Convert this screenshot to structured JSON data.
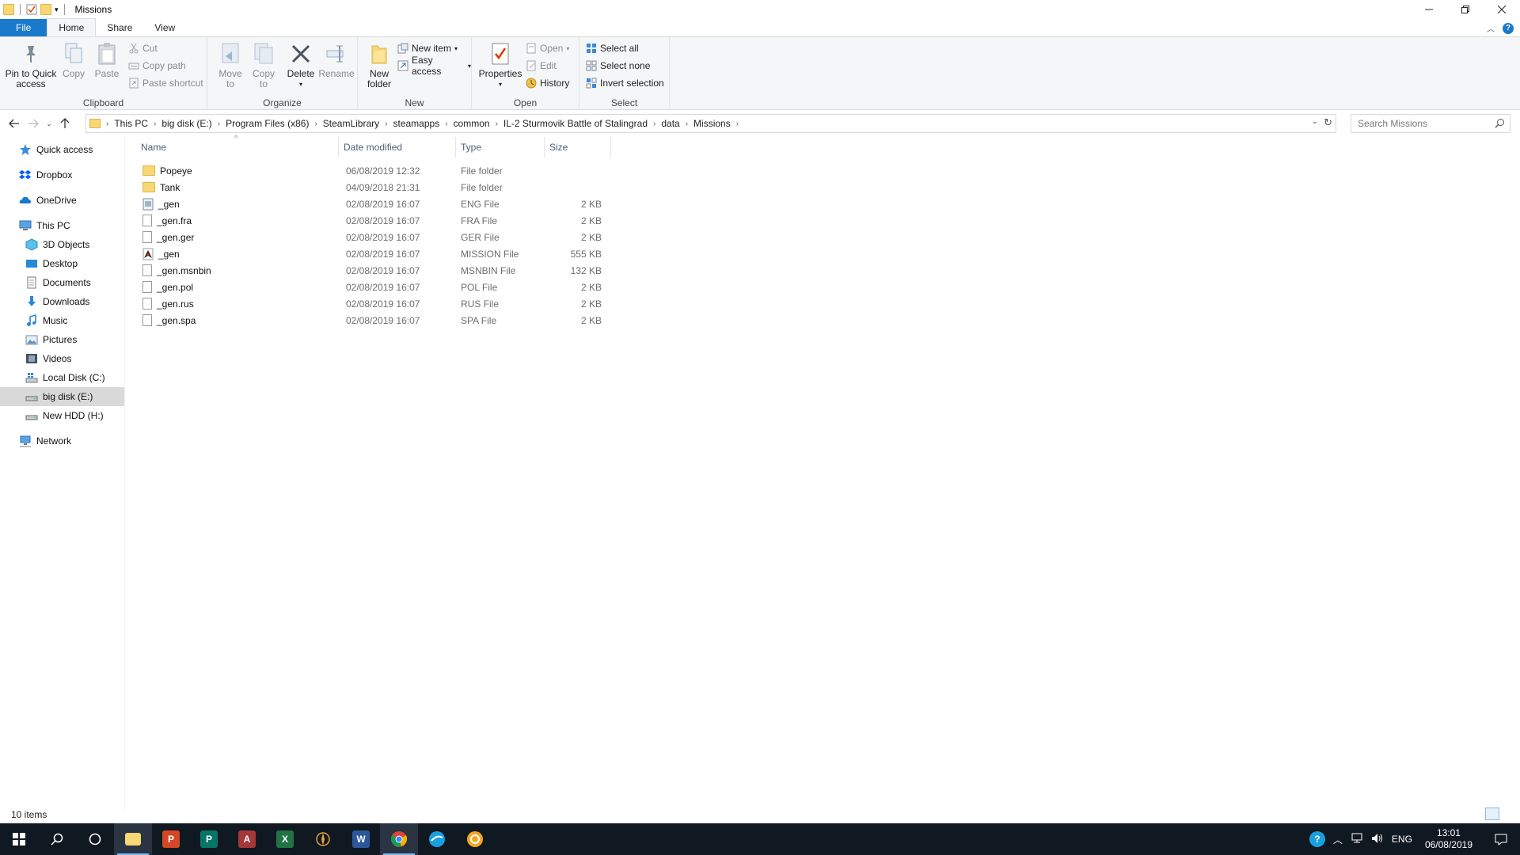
{
  "window": {
    "title": "Missions",
    "controls": [
      "minimize",
      "restore",
      "close"
    ]
  },
  "ribbon_tabs": [
    {
      "label": "File"
    },
    {
      "label": "Home"
    },
    {
      "label": "Share"
    },
    {
      "label": "View"
    }
  ],
  "ribbon": {
    "clipboard": {
      "label": "Clipboard",
      "pin_line1": "Pin to Quick",
      "pin_line2": "access",
      "copy": "Copy",
      "paste": "Paste",
      "cut": "Cut",
      "copy_path": "Copy path",
      "paste_shortcut": "Paste shortcut"
    },
    "organize": {
      "label": "Organize",
      "move_line1": "Move",
      "move_line2": "to",
      "copy_line1": "Copy",
      "copy_line2": "to",
      "delete": "Delete",
      "rename": "Rename"
    },
    "new": {
      "label": "New",
      "new_folder_line1": "New",
      "new_folder_line2": "folder",
      "new_item": "New item",
      "easy_access": "Easy access"
    },
    "open": {
      "label": "Open",
      "properties": "Properties",
      "open": "Open",
      "edit": "Edit",
      "history": "History"
    },
    "select": {
      "label": "Select",
      "select_all": "Select all",
      "select_none": "Select none",
      "invert_selection": "Invert selection"
    }
  },
  "address": {
    "breadcrumbs": [
      "This PC",
      "big disk (E:)",
      "Program Files (x86)",
      "SteamLibrary",
      "steamapps",
      "common",
      "IL-2 Sturmovik Battle of Stalingrad",
      "data",
      "Missions"
    ],
    "search_placeholder": "Search Missions"
  },
  "nav_pane": {
    "quick_access": "Quick access",
    "dropbox": "Dropbox",
    "onedrive": "OneDrive",
    "this_pc": "This PC",
    "objects_3d": "3D Objects",
    "desktop": "Desktop",
    "documents": "Documents",
    "downloads": "Downloads",
    "music": "Music",
    "pictures": "Pictures",
    "videos": "Videos",
    "local_disk": "Local Disk (C:)",
    "big_disk": "big disk (E:)",
    "new_hdd": "New HDD (H:)",
    "network": "Network"
  },
  "columns": {
    "name": "Name",
    "date": "Date modified",
    "type": "Type",
    "size": "Size"
  },
  "files": [
    {
      "name": "Popeye",
      "date": "06/08/2019 12:32",
      "type": "File folder",
      "size": "",
      "icon": "folder-icon"
    },
    {
      "name": "Tank",
      "date": "04/09/2018 21:31",
      "type": "File folder",
      "size": "",
      "icon": "folder-icon"
    },
    {
      "name": "_gen",
      "date": "02/08/2019 16:07",
      "type": "ENG File",
      "size": "2 KB",
      "icon": "eng-file-icon"
    },
    {
      "name": "_gen.fra",
      "date": "02/08/2019 16:07",
      "type": "FRA File",
      "size": "2 KB",
      "icon": "file-icon"
    },
    {
      "name": "_gen.ger",
      "date": "02/08/2019 16:07",
      "type": "GER File",
      "size": "2 KB",
      "icon": "file-icon"
    },
    {
      "name": "_gen",
      "date": "02/08/2019 16:07",
      "type": "MISSION File",
      "size": "555 KB",
      "icon": "mission-file-icon"
    },
    {
      "name": "_gen.msnbin",
      "date": "02/08/2019 16:07",
      "type": "MSNBIN File",
      "size": "132 KB",
      "icon": "file-icon"
    },
    {
      "name": "_gen.pol",
      "date": "02/08/2019 16:07",
      "type": "POL File",
      "size": "2 KB",
      "icon": "file-icon"
    },
    {
      "name": "_gen.rus",
      "date": "02/08/2019 16:07",
      "type": "RUS File",
      "size": "2 KB",
      "icon": "file-icon"
    },
    {
      "name": "_gen.spa",
      "date": "02/08/2019 16:07",
      "type": "SPA File",
      "size": "2 KB",
      "icon": "file-icon"
    }
  ],
  "status": {
    "item_count": "10 items"
  },
  "taskbar": {
    "apps": [
      "file-explorer",
      "powerpoint",
      "publisher",
      "access",
      "excel",
      "game-launcher",
      "word",
      "chrome",
      "steam",
      "browser-orange"
    ],
    "language": "ENG",
    "time": "13:01",
    "date": "06/08/2019"
  },
  "colors": {
    "accent": "#1979ca",
    "selected_nav": "#d9d9d9",
    "folder": "#f8d775",
    "taskbar": "#101822"
  }
}
